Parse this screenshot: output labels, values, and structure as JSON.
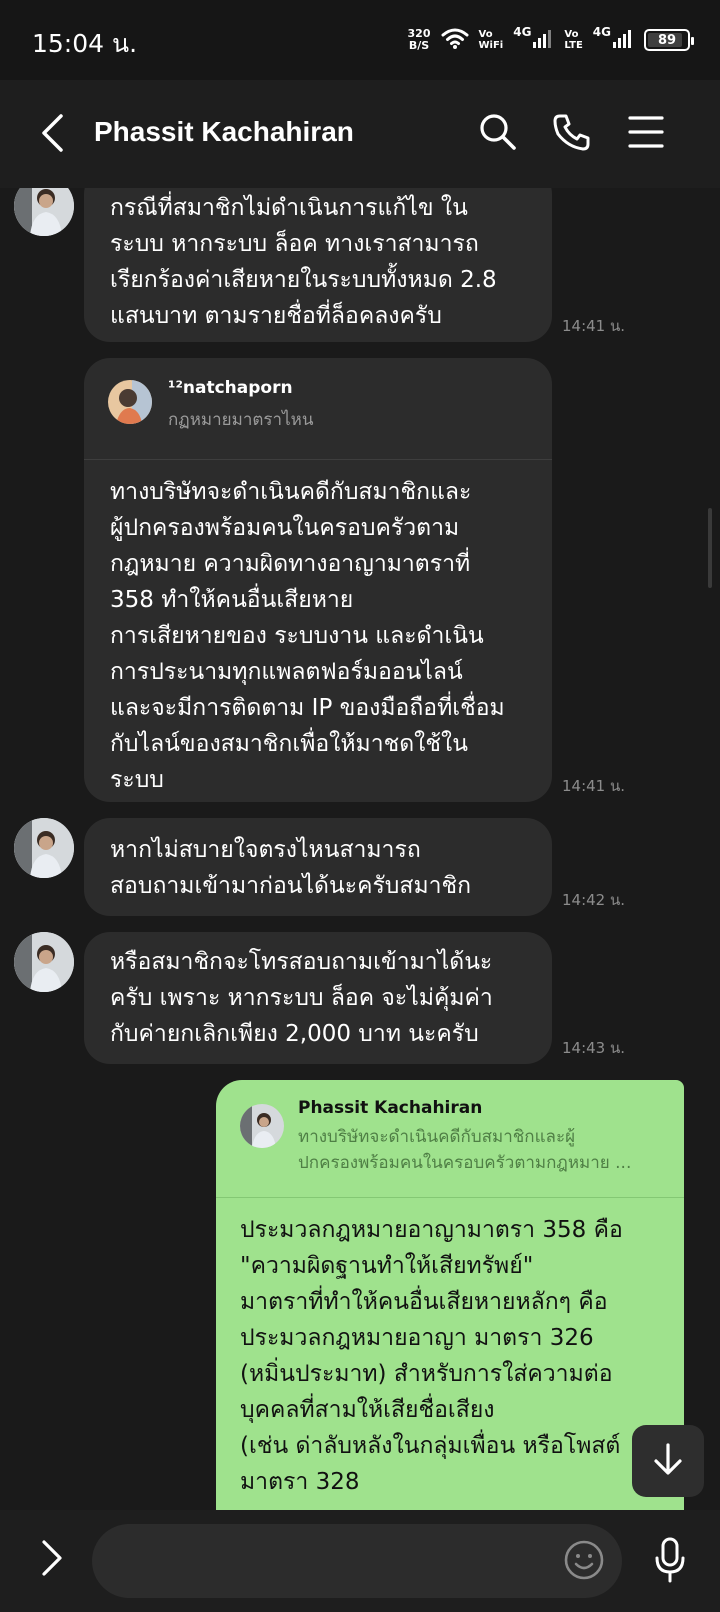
{
  "status_bar": {
    "time": "15:04 น.",
    "net_speed_value": "320",
    "net_speed_unit": "B/S",
    "vowifi_line1": "Vo",
    "vowifi_line2": "WiFi",
    "net1": "4G",
    "volte_line1": "Vo",
    "volte_line2": "LTE",
    "net2": "4G",
    "battery": "89",
    "battery_level": 0.89
  },
  "header": {
    "title": "Phassit Kachahiran"
  },
  "messages": [
    {
      "text": "กรณีที่สมาชิกไม่ดำเนินการแก้ไข ใน\nระบบ หากระบบ ล็อค ทางเราสามารถ\nเรียกร้องค่าเสียหายในระบบทั้งหมด 2.8\nแสนบาท ตามรายชื่อที่ล็อคลงครับ",
      "time": "14:41 น."
    },
    {
      "reply_name": "¹²natchaporn",
      "reply_snippet": "กฏหมายมาตราไหน",
      "text": "ทางบริษัทจะดำเนินคดีกับสมาชิกและ\nผู้ปกครองพร้อมคนในครอบครัวตาม\nกฎหมาย ความผิดทางอาญามาตราที่\n358 ทำให้คนอื่นเสียหาย\nการเสียหายของ ระบบงาน  และดำเนิน\nการประนามทุกแพลตฟอร์มออนไลน์\nและจะมีการติดตาม IP ของมือถือที่เชื่อม\nกับไลน์ของสมาชิกเพื่อให้มาชดใช้ใน\nระบบ",
      "time": "14:41 น."
    },
    {
      "text": "หากไม่สบายใจตรงไหนสามารถ\nสอบถามเข้ามาก่อนได้นะครับสมาชิก",
      "time": "14:42 น."
    },
    {
      "text": "หรือสมาชิกจะโทรสอบถามเข้ามาได้นะ\nครับ เพราะ หากระบบ ล็อค จะไม่คุ้มค่า\nกับค่ายกเลิกเพียง 2,000 บาท นะครับ",
      "time": "14:43 น."
    },
    {
      "reply_name": "Phassit Kachahiran",
      "reply_snippet": "ทางบริษัทจะดำเนินคดีกับสมาชิกและผู้\nปกครองพร้อมคนในครอบครัวตามกฎหมาย ...",
      "text": "ประมวลกฎหมายอาญามาตรา 358 คือ\n\"ความผิดฐานทำให้เสียทรัพย์\"\nมาตราที่ทำให้คนอื่นเสียหายหลักๆ คือ\nประมวลกฎหมายอาญา มาตรา 326\n(หมิ่นประมาท) สำหรับการใส่ความต่อ\nบุคคลที่สามให้เสียชื่อเสียง\n(เช่น ด่าลับหลังในกลุ่มเพื่อน หรือโพสต์\n      มาตรา 328"
    }
  ],
  "input": {
    "placeholder": ""
  },
  "icons": {
    "back": "chevron-left-icon",
    "search": "search-icon",
    "call": "phone-icon",
    "menu": "menu-icon",
    "scroll_down": "arrow-down-icon",
    "expand": "chevron-right-icon",
    "emoji": "emoji-icon",
    "mic": "microphone-icon"
  },
  "colors": {
    "background": "#1a1a1a",
    "incoming_bubble": "#2c2c2c",
    "outgoing_bubble": "#9fe28d",
    "timestamp": "#8c8c8c"
  }
}
